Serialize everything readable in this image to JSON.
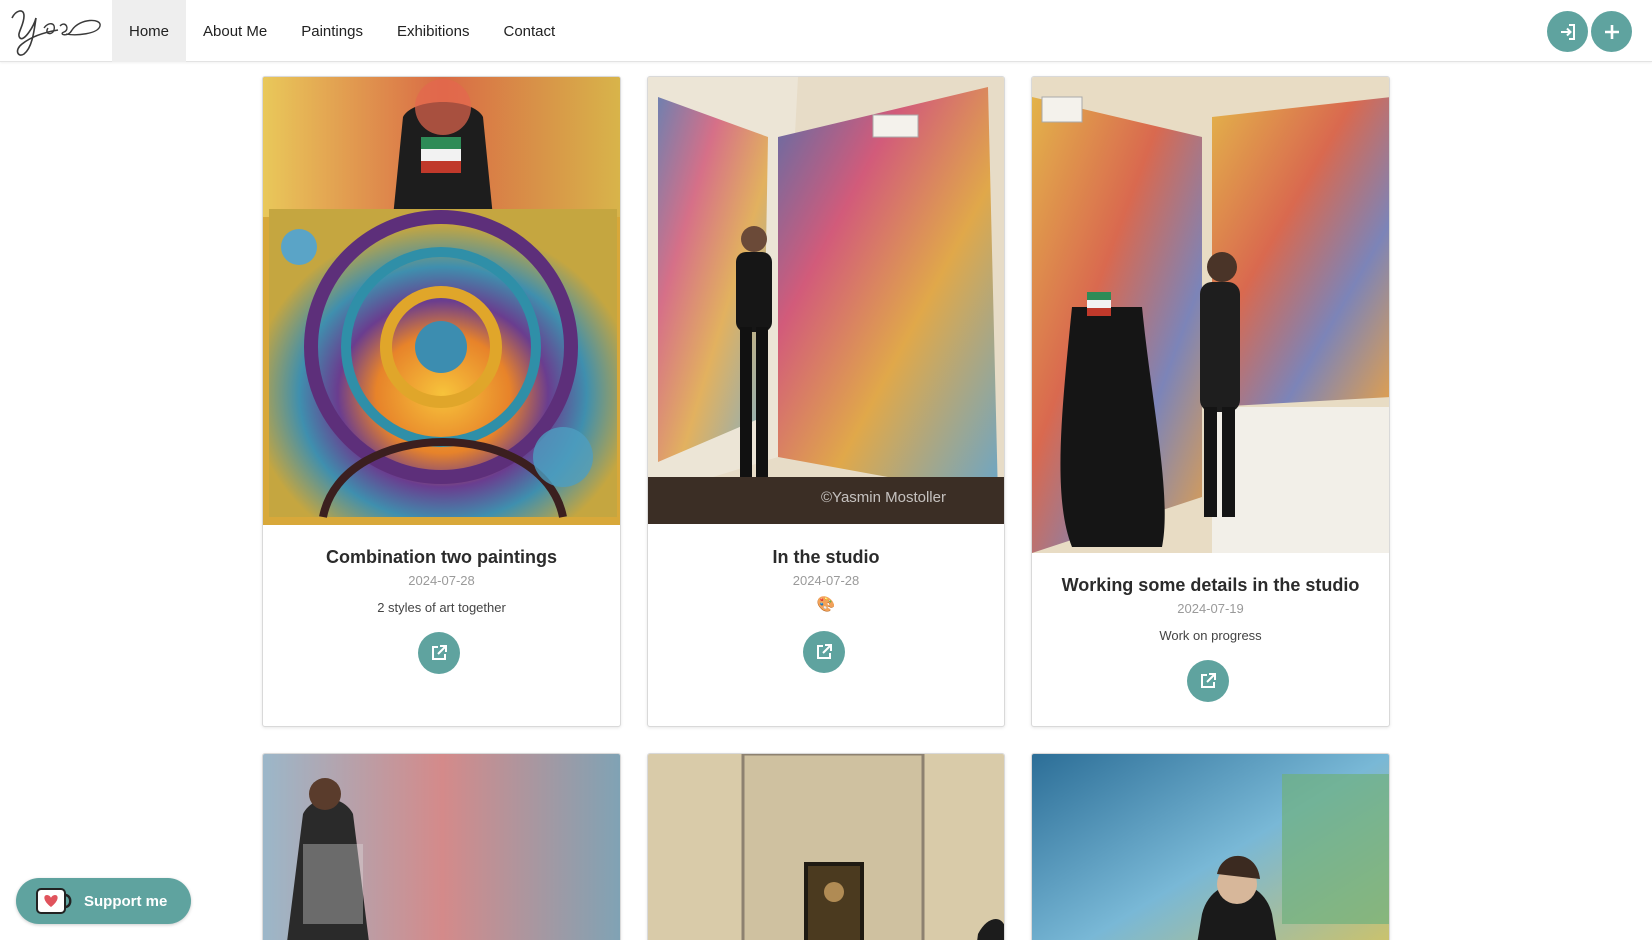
{
  "logo": {
    "text": "Yas"
  },
  "nav": {
    "items": [
      "Home",
      "About Me",
      "Paintings",
      "Exhibitions",
      "Contact"
    ],
    "active": "Home",
    "login_icon": "sign-in-icon",
    "add_icon": "plus-icon"
  },
  "cards": [
    {
      "title": "Combination two paintings",
      "date": "2024-07-28",
      "description": "2 styles of art together"
    },
    {
      "title": "In the studio",
      "date": "2024-07-28",
      "description": "🎨",
      "watermark": "©Yasmin Mostoller"
    },
    {
      "title": "Working some details in the studio",
      "date": "2024-07-19",
      "description": "Work on progress"
    }
  ],
  "support": {
    "label": "Support me",
    "icon": "coffee-cup-heart-icon"
  },
  "colors": {
    "accent": "#5fa39f",
    "active_nav_bg": "#eeeeee"
  }
}
